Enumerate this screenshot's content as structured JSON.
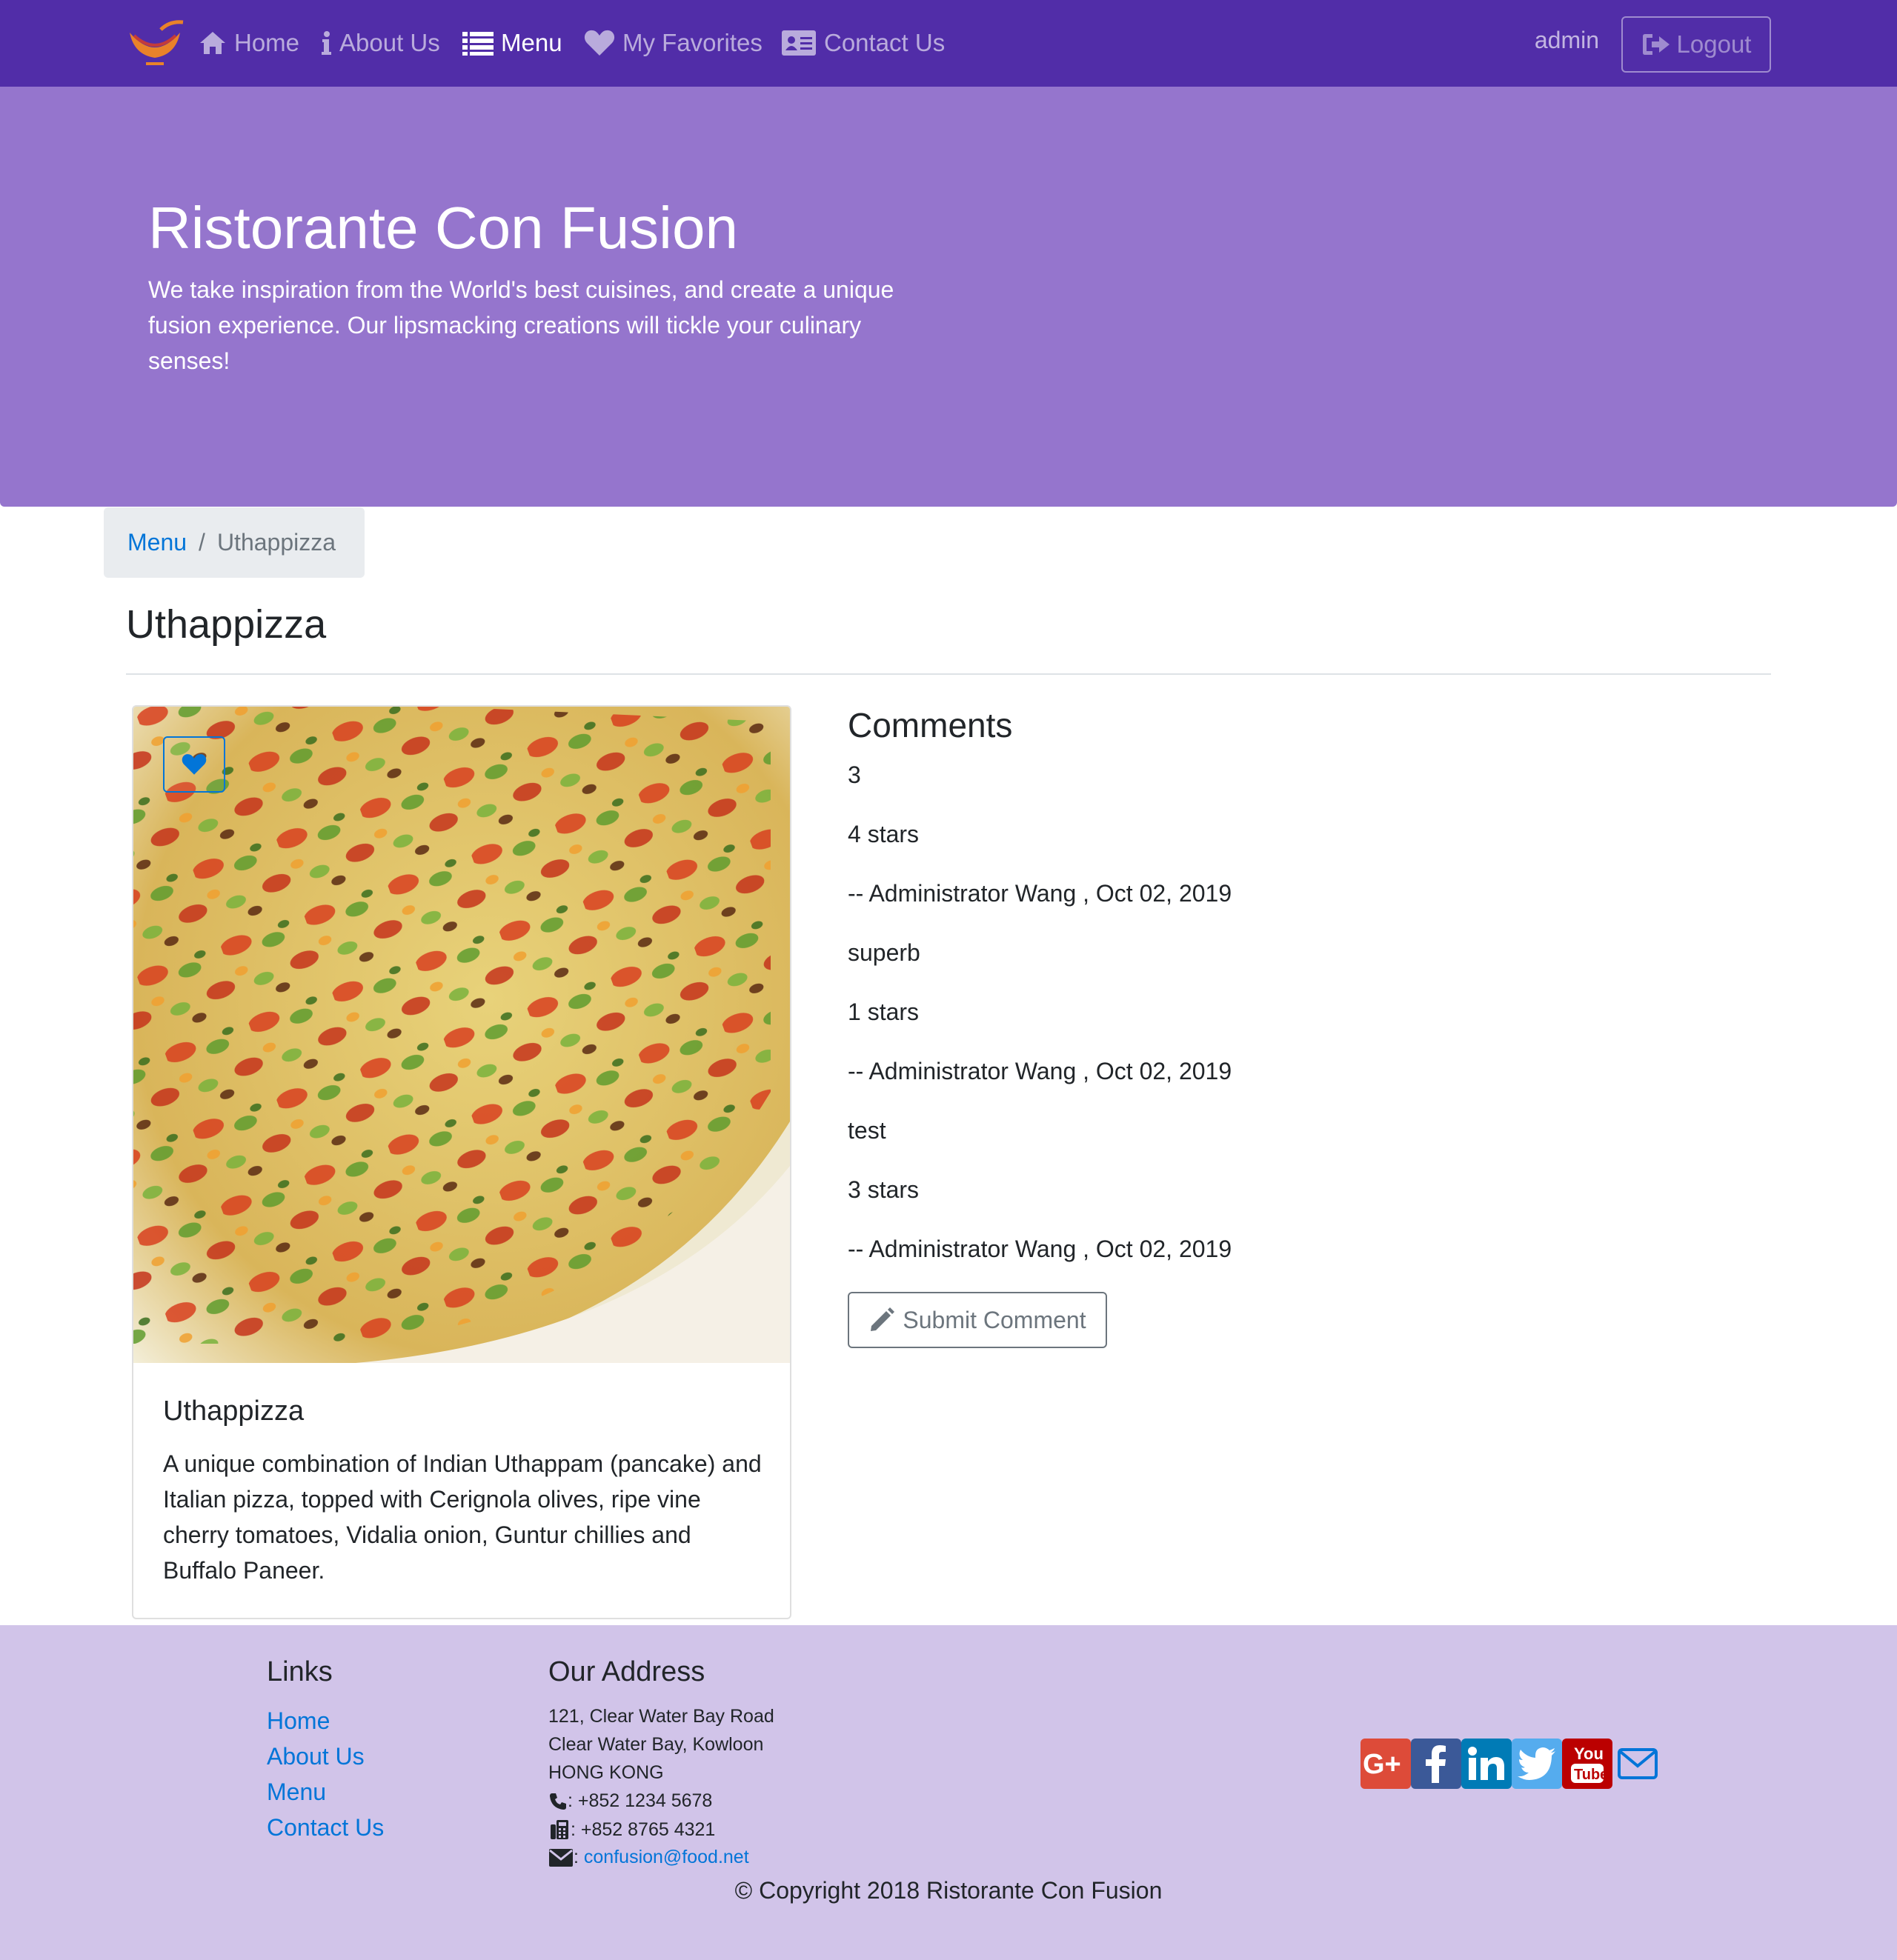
{
  "nav": {
    "items": [
      {
        "label": "Home",
        "icon": "home-icon"
      },
      {
        "label": "About Us",
        "icon": "info-icon"
      },
      {
        "label": "Menu",
        "icon": "list-icon",
        "active": true
      },
      {
        "label": "My Favorites",
        "icon": "heart-icon"
      },
      {
        "label": "Contact Us",
        "icon": "address-card-icon"
      }
    ],
    "user": "admin",
    "logout_label": "Logout"
  },
  "jumbotron": {
    "title": "Ristorante Con Fusion",
    "text": "We take inspiration from the World's best cuisines, and create a unique fusion experience. Our lipsmacking creations will tickle your culinary senses!"
  },
  "breadcrumb": {
    "link": "Menu",
    "active": "Uthappizza"
  },
  "page_title": "Uthappizza",
  "dish": {
    "name": "Uthappizza",
    "description": "A unique combination of Indian Uthappam (pancake) and Italian pizza, topped with Cerignola olives, ripe vine cherry tomatoes, Vidalia onion, Guntur chillies and Buffalo Paneer."
  },
  "comments": {
    "title": "Comments",
    "lines": [
      "3",
      "4 stars",
      "-- Administrator Wang , Oct 02, 2019",
      "superb",
      "1 stars",
      "-- Administrator Wang , Oct 02, 2019",
      "test",
      "3 stars",
      "-- Administrator Wang , Oct 02, 2019"
    ],
    "submit_label": "Submit Comment"
  },
  "footer": {
    "links_title": "Links",
    "links": [
      "Home",
      "About Us",
      "Menu",
      "Contact Us"
    ],
    "address_title": "Our Address",
    "address": [
      "121, Clear Water Bay Road",
      "Clear Water Bay, Kowloon",
      "HONG KONG"
    ],
    "phone": ": +852 1234 5678",
    "fax": ": +852 8765 4321",
    "email_sep": ":",
    "email": "confusion@food.net",
    "copyright": "© Copyright 2018 Ristorante Con Fusion",
    "social": [
      {
        "name": "google-plus",
        "color": "#dd4b39"
      },
      {
        "name": "facebook",
        "color": "#3b5998"
      },
      {
        "name": "linkedin",
        "color": "#007bb6"
      },
      {
        "name": "twitter",
        "color": "#55acee"
      },
      {
        "name": "youtube",
        "color": "#bb0000"
      },
      {
        "name": "mail",
        "color": "#0275d8"
      }
    ]
  },
  "colors": {
    "navbar": "#512DA8",
    "jumbotron": "#9575CD",
    "footer": "#D1C4E9",
    "link": "#0275d8"
  }
}
